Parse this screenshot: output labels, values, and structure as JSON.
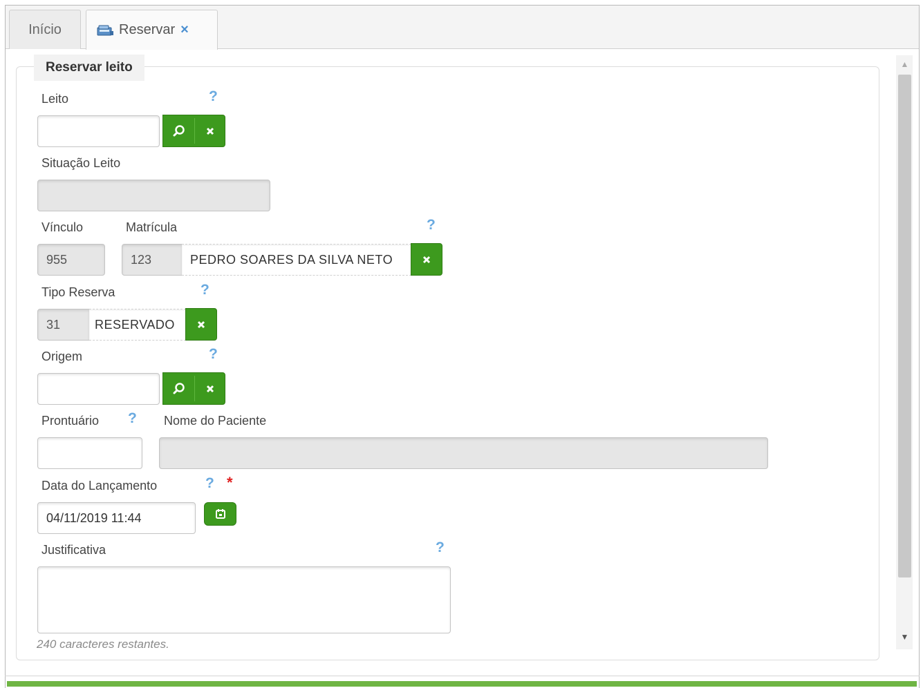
{
  "tabs": [
    {
      "label": "Início"
    },
    {
      "label": "Reservar",
      "close": "×"
    }
  ],
  "panel": {
    "legend": "Reservar leito"
  },
  "form": {
    "leito": {
      "label": "Leito",
      "help": "?",
      "value": ""
    },
    "situacao": {
      "label": "Situação Leito",
      "value": ""
    },
    "vinculo": {
      "label": "Vínculo",
      "value": "955"
    },
    "matricula": {
      "label": "Matrícula",
      "help": "?",
      "code": "123",
      "name": "PEDRO SOARES DA SILVA NETO"
    },
    "tipo_reserva": {
      "label": "Tipo Reserva",
      "help": "?",
      "code": "31",
      "name": "RESERVADO"
    },
    "origem": {
      "label": "Origem",
      "help": "?",
      "value": ""
    },
    "prontuario": {
      "label": "Prontuário",
      "help": "?",
      "value": ""
    },
    "nome_paciente": {
      "label": "Nome do Paciente",
      "value": ""
    },
    "data_lancamento": {
      "label": "Data do Lançamento",
      "help": "?",
      "required_mark": "*",
      "value": "04/11/2019 11:44"
    },
    "justificativa": {
      "label": "Justificativa",
      "help": "?",
      "value": "",
      "counter": "240 caracteres restantes."
    }
  },
  "icons": {
    "search": "search-icon",
    "clear": "clear-icon",
    "calendar": "calendar-icon",
    "tab": "reserve-icon"
  },
  "colors": {
    "accent_green": "#3d9a1e",
    "help_blue": "#6aaae0",
    "required_red": "#e02020",
    "footer_green": "#6fb544"
  }
}
